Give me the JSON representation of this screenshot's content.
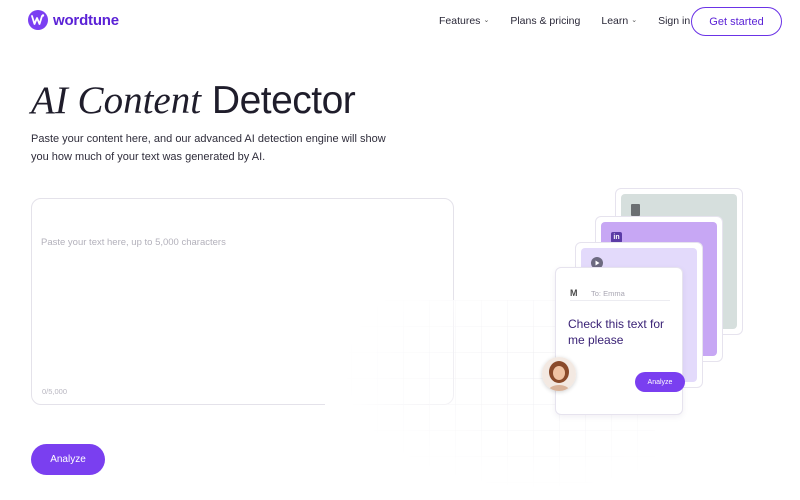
{
  "brand": {
    "name": "wordtune",
    "color": "#7b3ff2"
  },
  "nav": {
    "items": [
      {
        "label": "Features",
        "dropdown": true
      },
      {
        "label": "Plans & pricing",
        "dropdown": false
      },
      {
        "label": "Learn",
        "dropdown": true
      },
      {
        "label": "Sign in",
        "dropdown": false
      }
    ],
    "cta": "Get started"
  },
  "hero": {
    "title_italic": "AI Content",
    "title_bold": "Detector",
    "subtitle": "Paste your content here, and our advanced AI detection engine will show you how much of your text was generated by AI."
  },
  "editor": {
    "placeholder": "Paste your text here, up to 5,000 characters",
    "char_count": "0/5,000",
    "analyze_label": "Analyze"
  },
  "illustration": {
    "icons": [
      "document-icon",
      "linkedin-icon",
      "play-icon",
      "gmail-icon"
    ],
    "linkedin_glyph": "in",
    "gmail_glyph": "M",
    "mail_to": "To: Emma",
    "mail_body": "Check this text for me please",
    "analyze_label": "Analyze"
  },
  "colors": {
    "accent": "#7a3ff0",
    "card_green": "#d6dfdd",
    "card_purple": "#c7a7f4",
    "card_lavender": "#e3dafb"
  }
}
